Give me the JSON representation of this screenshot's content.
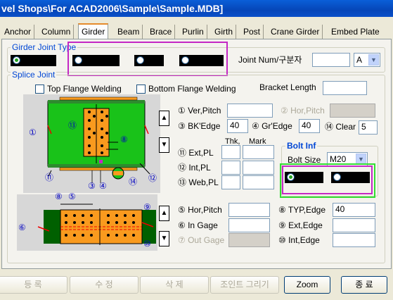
{
  "window": {
    "title": "vel Shops\\For ACAD2006\\Sample\\Sample.MDB]"
  },
  "tabs": [
    {
      "label": "Anchor"
    },
    {
      "label": "Column"
    },
    {
      "label": "Girder"
    },
    {
      "label": "Beam"
    },
    {
      "label": "Brace"
    },
    {
      "label": "Purlin"
    },
    {
      "label": "Girth"
    },
    {
      "label": "Post"
    },
    {
      "label": "Crane Girder"
    },
    {
      "label": "Embed Plate"
    }
  ],
  "active_tab": "Girder",
  "girder_joint": {
    "group_label": "Girder Joint Type",
    "joint_num_label": "Joint Num/구분자",
    "joint_num_value": "",
    "joint_code": "A"
  },
  "splice": {
    "group_label": "Splice Joint",
    "top_flange_welding": "Top Flange Welding",
    "bottom_flange_welding": "Bottom Flange Welding",
    "bracket_length_label": "Bracket Length",
    "bracket_length_value": ""
  },
  "fields": {
    "ver_pitch": {
      "label": "① Ver,Pitch",
      "value": ""
    },
    "hor_pitch_top": {
      "label": "② Hor,Pitch",
      "value": ""
    },
    "bk_edge": {
      "label": "③ BK'Edge",
      "value": "40"
    },
    "gr_edge": {
      "label": "④ Gr'Edge",
      "value": "40"
    },
    "clear": {
      "label": "⑭ Clear",
      "value": "5"
    },
    "thk_header": "Thk,",
    "mark_header": "Mark",
    "ext_pl": {
      "label": "⑪ Ext,PL",
      "thk": "",
      "mark": ""
    },
    "int_pl": {
      "label": "⑫ Int,PL",
      "thk": "",
      "mark": ""
    },
    "web_pl": {
      "label": "⑬ Web,PL",
      "thk": "",
      "mark": ""
    },
    "hor_pitch": {
      "label": "⑤ Hor,Pitch",
      "value": ""
    },
    "in_gage": {
      "label": "⑥ In Gage",
      "value": ""
    },
    "out_gage": {
      "label": "⑦ Out Gage",
      "value": ""
    },
    "typ_edge": {
      "label": "⑧ TYP,Edge",
      "value": "40"
    },
    "ext_edge": {
      "label": "⑨ Ext,Edge",
      "value": ""
    },
    "int_edge": {
      "label": "⑩ Int,Edge",
      "value": ""
    }
  },
  "bolt": {
    "group_label": "Bolt Inf",
    "size_label": "Bolt Size",
    "size_value": "M20"
  },
  "diagram_labels": {
    "n1": "①",
    "n3": "③",
    "n4": "④",
    "n5": "⑤",
    "n6": "⑥",
    "n8": "⑧",
    "n9": "⑨",
    "n10": "⑩",
    "n11": "⑪",
    "n12": "⑫",
    "n13": "⑬",
    "n14": "⑭"
  },
  "buttons": {
    "register": "등 록",
    "modify": "수 정",
    "delete": "삭 제",
    "draw_joint": "조인트 그리기",
    "zoom": "Zoom",
    "close": "종 료"
  },
  "colors": {
    "highlight_magenta": "#c428c4",
    "highlight_green": "#33dd33",
    "plate_orange": "#f99a1e",
    "flange_green": "#19c219",
    "title_blue": "#0a5fd8"
  }
}
